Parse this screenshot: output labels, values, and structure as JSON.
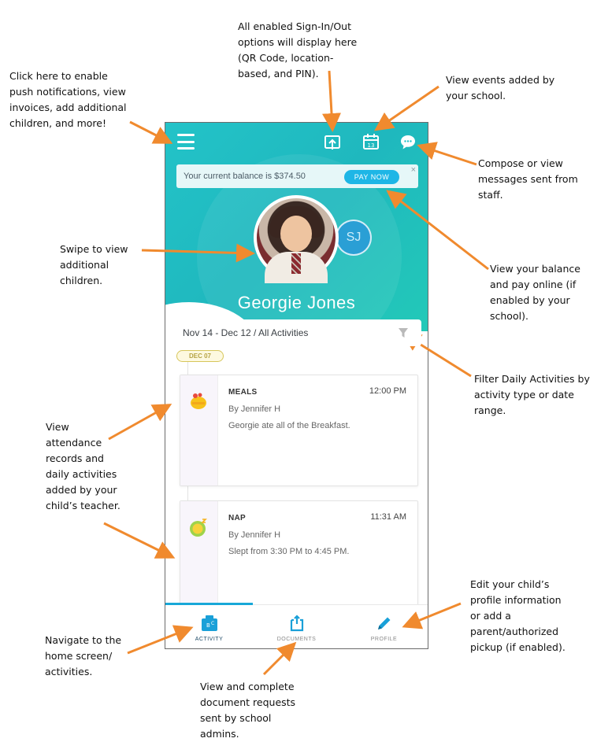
{
  "annotations": {
    "menu": "Click here to enable\npush notifications, view\ninvoices, add additional\nchildren, and more!",
    "signin": "All enabled Sign-In/Out\noptions will display here\n(QR Code, location-\nbased, and PIN).",
    "events": "View events added by\nyour school.",
    "messages": "Compose or view\nmessages sent from\nstaff.",
    "swipe": "Swipe to view\nadditional\nchildren.",
    "balance": "View your balance\nand pay online (if\nenabled by your\nschool).",
    "filter": "Filter Daily Activities by\nactivity type or date\nrange.",
    "attendance": "View\nattendance\nrecords and\ndaily activities\nadded by your\nchild’s teacher.",
    "profile": "Edit your child’s\nprofile information\nor add a\nparent/authorized\npickup (if enabled).",
    "home": "Navigate to the\nhome screen/\nactivities.",
    "documents": "View and complete\ndocument requests\nsent by school\nadmins."
  },
  "app": {
    "balance_text": "Your current balance is $374.50",
    "pay_now_label": "PAY NOW",
    "close_glyph": "×",
    "secondary_child_initials": "SJ",
    "child_name": "Georgie Jones",
    "filter_text": "Nov 14 - Dec 12 / All Activities",
    "date_badge": "DEC 07",
    "activities": [
      {
        "type": "MEALS",
        "time": "12:00 PM",
        "by": "By Jennifer H",
        "description": "Georgie ate all of the Breakfast."
      },
      {
        "type": "NAP",
        "time": "11:31 AM",
        "by": "By Jennifer H",
        "description": "Slept from 3:30 PM to 4:45 PM."
      }
    ],
    "tabs": [
      {
        "label": "ACTIVITY",
        "active": true
      },
      {
        "label": "DOCUMENTS",
        "active": false
      },
      {
        "label": "PROFILE",
        "active": false
      }
    ]
  },
  "colors": {
    "header_teal": "#23c3c8",
    "arrow_orange": "#f08a2e",
    "pay_button_blue": "#1eb6e6",
    "active_tab_blue": "#18a8d8"
  },
  "icons": [
    "menu-icon",
    "sign-in-out-icon",
    "calendar-icon",
    "message-icon",
    "close-icon",
    "filter-icon",
    "meals-icon",
    "nap-icon",
    "activity-icon",
    "documents-icon",
    "profile-pencil-icon"
  ]
}
